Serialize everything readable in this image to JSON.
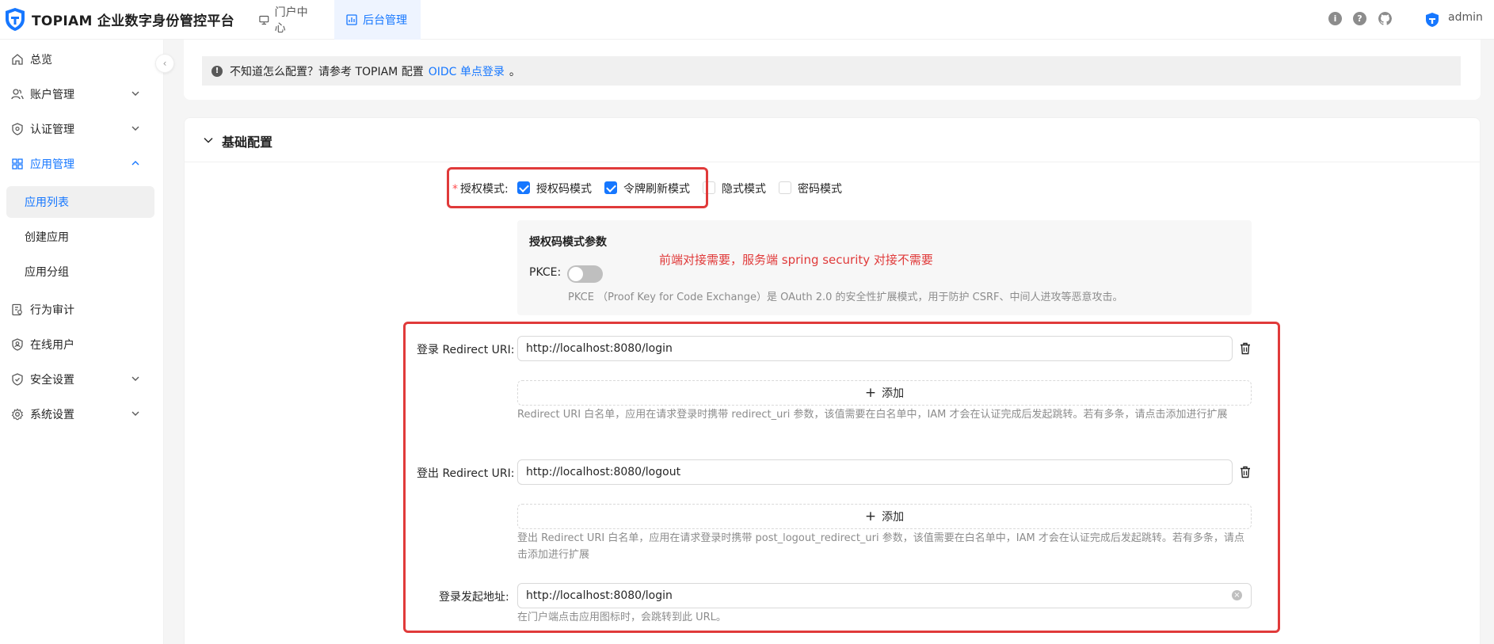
{
  "header": {
    "brand": "TOPIAM 企业数字身份管控平台",
    "nav": [
      {
        "label": "门户中心",
        "icon": "monitor-icon"
      },
      {
        "label": "后台管理",
        "icon": "dashboard-icon"
      }
    ],
    "icons": [
      "info-icon",
      "help-icon",
      "github-icon"
    ],
    "user": "admin"
  },
  "sidebar": {
    "items": [
      {
        "label": "总览",
        "icon": "home-icon"
      },
      {
        "label": "账户管理",
        "icon": "users-icon"
      },
      {
        "label": "认证管理",
        "icon": "shield-icon"
      },
      {
        "label": "应用管理",
        "icon": "apps-icon"
      },
      {
        "label": "行为审计",
        "icon": "audit-icon"
      },
      {
        "label": "在线用户",
        "icon": "online-user-icon"
      },
      {
        "label": "安全设置",
        "icon": "security-icon"
      },
      {
        "label": "系统设置",
        "icon": "settings-icon"
      }
    ],
    "sub_items": [
      {
        "label": "应用列表"
      },
      {
        "label": "创建应用"
      },
      {
        "label": "应用分组"
      }
    ]
  },
  "alert": {
    "text_before": "不知道怎么配置？请参考 TOPIAM 配置",
    "link": "OIDC 单点登录",
    "text_after": "。"
  },
  "section": {
    "title": "基础配置"
  },
  "grant": {
    "label": "授权模式:",
    "options": [
      {
        "label": "授权码模式",
        "checked": true
      },
      {
        "label": "令牌刷新模式",
        "checked": true
      },
      {
        "label": "隐式模式",
        "checked": false
      },
      {
        "label": "密码模式",
        "checked": false
      }
    ]
  },
  "params": {
    "title": "授权码模式参数",
    "pkce_label": "PKCE:",
    "pkce_enabled": false,
    "pkce_help": "PKCE （Proof Key for Code Exchange）是 OAuth 2.0 的安全性扩展模式，用于防护 CSRF、中间人进攻等恶意攻击。"
  },
  "annotation": "前端对接需要，服务端 spring security 对接不需要",
  "redirect": {
    "label": "登录 Redirect URI:",
    "value": "http://localhost:8080/login",
    "add_label": "添加",
    "help": "Redirect URI 白名单，应用在请求登录时携带 redirect_uri 参数，该值需要在白名单中，IAM 才会在认证完成后发起跳转。若有多条，请点击添加进行扩展"
  },
  "logout_redirect": {
    "label": "登出 Redirect URI:",
    "value": "http://localhost:8080/logout",
    "add_label": "添加",
    "help": "登出 Redirect URI 白名单，应用在请求登录时携带 post_logout_redirect_uri 参数，该值需要在白名单中，IAM 才会在认证完成后发起跳转。若有多条，请点击添加进行扩展"
  },
  "init_url": {
    "label": "登录发起地址:",
    "value": "http://localhost:8080/login",
    "help": "在门户端点击应用图标时，会跳转到此 URL。"
  },
  "colors": {
    "accent": "#1677ff",
    "annotation": "#e03a3a"
  }
}
